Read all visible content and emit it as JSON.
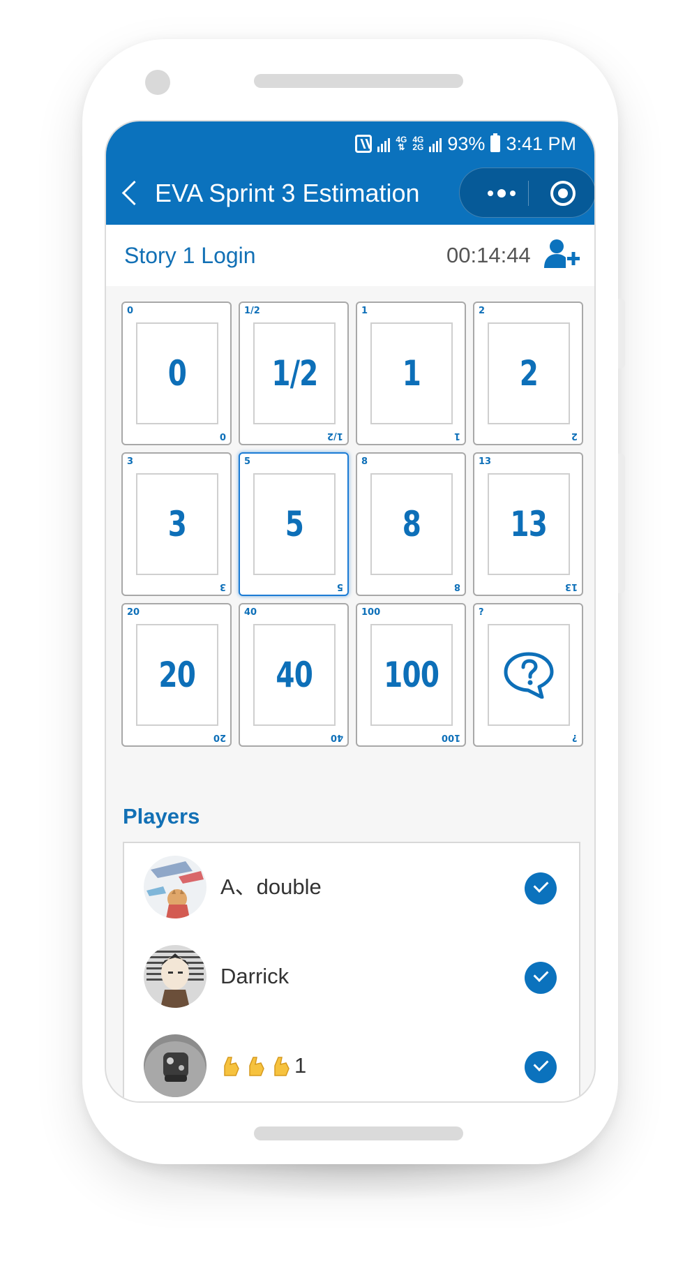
{
  "status_bar": {
    "battery": "93%",
    "time": "3:41 PM",
    "net_top": "4G",
    "net_bottom": "2G"
  },
  "nav": {
    "title": "EVA Sprint 3 Estimation"
  },
  "story": {
    "title": "Story 1 Login",
    "timer": "00:14:44"
  },
  "cards": [
    {
      "value": "0",
      "selected": false
    },
    {
      "value": "1/2",
      "selected": false
    },
    {
      "value": "1",
      "selected": false
    },
    {
      "value": "2",
      "selected": false
    },
    {
      "value": "3",
      "selected": false
    },
    {
      "value": "5",
      "selected": true
    },
    {
      "value": "8",
      "selected": false
    },
    {
      "value": "13",
      "selected": false
    },
    {
      "value": "20",
      "selected": false
    },
    {
      "value": "40",
      "selected": false
    },
    {
      "value": "100",
      "selected": false
    },
    {
      "value": "?",
      "selected": false,
      "icon": "question-bubble-icon"
    }
  ],
  "players": {
    "title": "Players",
    "items": [
      {
        "name": "A、double",
        "voted": true
      },
      {
        "name": "Darrick",
        "voted": true
      },
      {
        "name": "1",
        "prefix_icon": "pointing-hands-emoji",
        "voted": true
      }
    ]
  },
  "colors": {
    "primary": "#0b72bd",
    "accent_text": "#1270b5",
    "card_text": "#0d6fb8"
  }
}
